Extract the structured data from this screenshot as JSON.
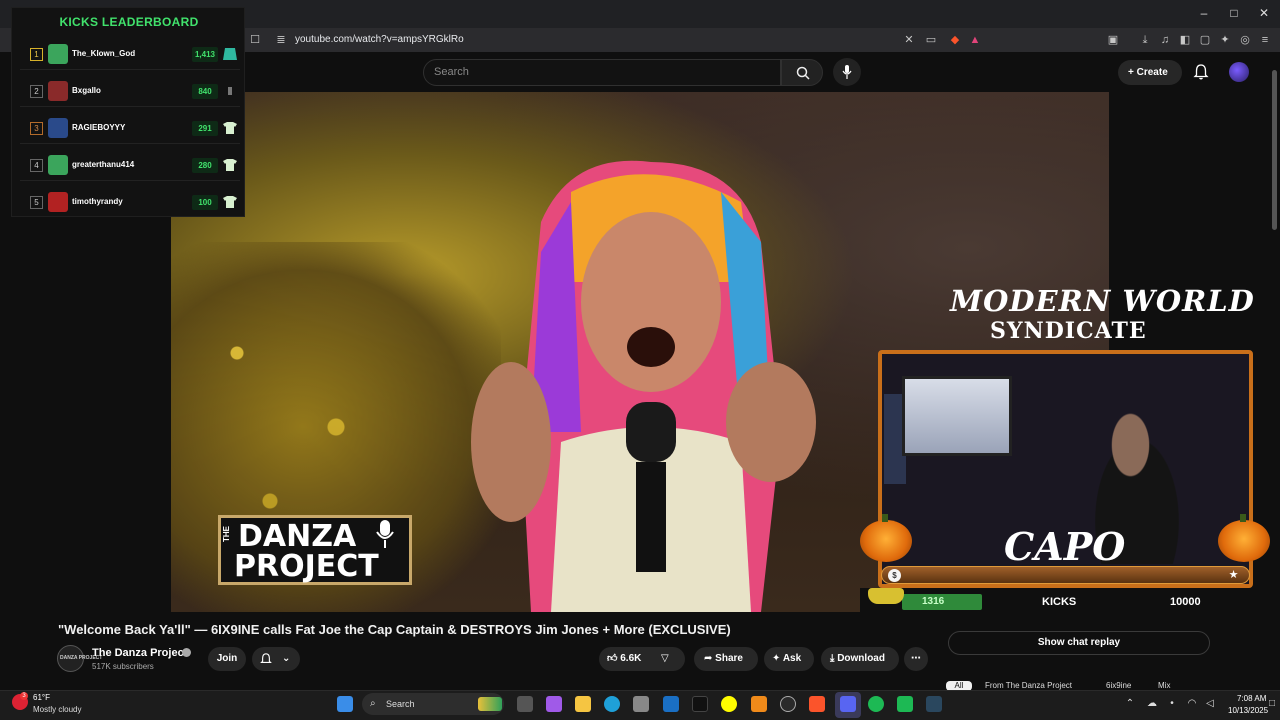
{
  "browser": {
    "url": "youtube.com/watch?v=ampsYRGklRo",
    "window_controls": [
      "–",
      "□",
      "✕"
    ]
  },
  "youtube_header": {
    "search_placeholder": "Search",
    "create_label": "Create"
  },
  "leaderboard": {
    "title": "KICKS LEADERBOARD",
    "rows": [
      {
        "rank": "1",
        "name": "The_Klown_God",
        "score": "1,413",
        "avatar_color": "#3ba55c"
      },
      {
        "rank": "2",
        "name": "Bxgallo",
        "score": "840",
        "avatar_color": "#8a2a2a"
      },
      {
        "rank": "3",
        "name": "RAGIEBOYYY",
        "score": "291",
        "avatar_color": "#2a4a8a"
      },
      {
        "rank": "4",
        "name": "greaterthanu414",
        "score": "280",
        "avatar_color": "#3ba55c"
      },
      {
        "rank": "5",
        "name": "timothyrandy",
        "score": "100",
        "avatar_color": "#b22222"
      }
    ]
  },
  "video_overlay": {
    "brand_line1": "MODERN WORLD",
    "brand_line2": "SYNDICATE",
    "logo_side": "THE",
    "logo_line1": "DANZA",
    "logo_line2": "PROJECT",
    "streamer_name": "CAPO",
    "goal": {
      "current": "1316",
      "label": "KICKS",
      "target": "10000",
      "progress": 0.1316
    }
  },
  "video": {
    "title": "\"Welcome Back Ya'll\" — 6IX9INE calls Fat Joe the Cap Captain & DESTROYS Jim Jones + More (EXCLUSIVE)",
    "channel_name": "The Danza Project",
    "channel_avatar_text": "DANZA PROJECT",
    "subscribers": "517K subscribers",
    "join_label": "Join",
    "likes": "6.6K",
    "share_label": "Share",
    "ask_label": "Ask",
    "download_label": "Download",
    "more_label": "⋯"
  },
  "side_panel": {
    "chat_replay_label": "Show chat replay",
    "chips": [
      "All",
      "From The Danza Project",
      "6ix9ine",
      "Mix"
    ]
  },
  "taskbar": {
    "weather_temp": "61°F",
    "weather_desc": "Mostly cloudy",
    "weather_badge": "3",
    "search_label": "Search",
    "time": "7:08 AM",
    "date": "10/13/2025",
    "apps": [
      {
        "name": "windows-start-icon",
        "color": "#3a8de8"
      },
      {
        "name": "task-view-icon",
        "color": "#555"
      },
      {
        "name": "copilot-icon",
        "color": "#a05ae8"
      },
      {
        "name": "file-explorer-icon",
        "color": "#f5c542"
      },
      {
        "name": "edge-icon",
        "color": "#1fa0d8"
      },
      {
        "name": "store-icon",
        "color": "#888"
      },
      {
        "name": "outlook-icon",
        "color": "#1a6fc4"
      },
      {
        "name": "tiktok-icon",
        "color": "#111"
      },
      {
        "name": "snapchat-icon",
        "color": "#fffc00"
      },
      {
        "name": "vlc-icon",
        "color": "#f08a1a"
      },
      {
        "name": "obs-icon",
        "color": "#2a2a2a"
      },
      {
        "name": "brave-icon",
        "color": "#fb542b"
      },
      {
        "name": "discord-icon",
        "color": "#5865f2"
      },
      {
        "name": "spotify-icon",
        "color": "#1db954"
      },
      {
        "name": "xbox-icon",
        "color": "#1db954"
      },
      {
        "name": "steam-icon",
        "color": "#2a475e"
      }
    ]
  }
}
